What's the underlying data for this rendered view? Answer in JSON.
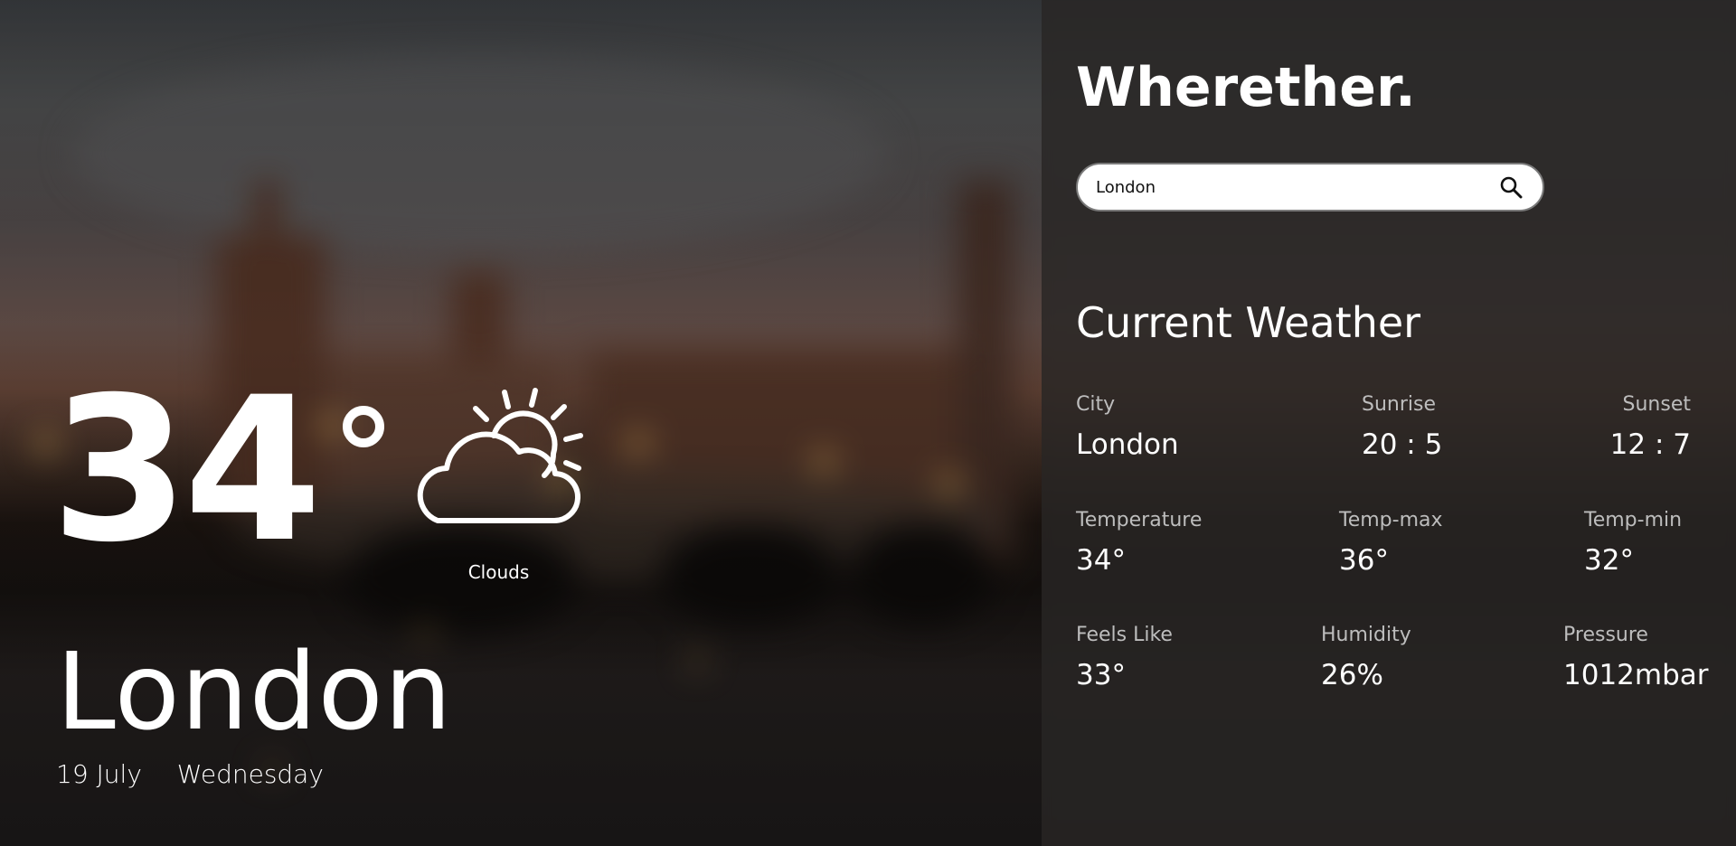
{
  "app": {
    "brand": "Wherether.",
    "search": {
      "value": "London",
      "placeholder": ""
    }
  },
  "hero": {
    "temperature": "34",
    "condition": "Clouds",
    "city": "London",
    "date": "19 July",
    "weekday": "Wednesday"
  },
  "current": {
    "title": "Current Weather",
    "city_label": "City",
    "city_value": "London",
    "sunrise_label": "Sunrise",
    "sunrise_value": "20 : 5",
    "sunset_label": "Sunset",
    "sunset_value": "12 : 7",
    "temp_label": "Temperature",
    "temp_value": "34°",
    "tempmax_label": "Temp-max",
    "tempmax_value": "36°",
    "tempmin_label": "Temp-min",
    "tempmin_value": "32°",
    "feels_label": "Feels Like",
    "feels_value": "33°",
    "humidity_label": "Humidity",
    "humidity_value": "26%",
    "pressure_label": "Pressure",
    "pressure_value": "1012mbar"
  },
  "icons": {
    "weather": "partly-cloudy-icon",
    "search": "search-icon"
  }
}
